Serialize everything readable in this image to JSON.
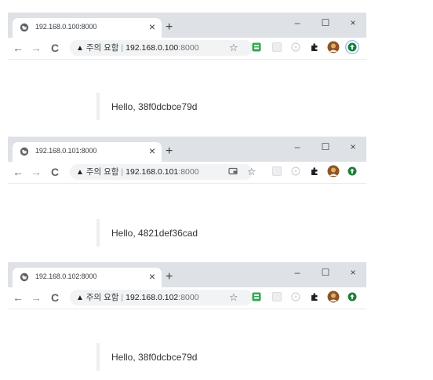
{
  "windows": [
    {
      "tab_title": "192.168.0.100:8000",
      "tab_close": "×",
      "new_tab": "+",
      "window_controls": {
        "minimize": "–",
        "maximize": "☐",
        "close": "×"
      },
      "nav": {
        "back": "←",
        "forward": "→",
        "reload": "C"
      },
      "security_warning": "주의 요함",
      "url_host": "192.168.0.100",
      "url_port": ":8000",
      "page_text": "Hello, 38f0dcbce79d",
      "has_cast_icon": false,
      "has_green_extension": true,
      "profile_focused": true
    },
    {
      "tab_title": "192.168.0.101:8000",
      "tab_close": "×",
      "new_tab": "+",
      "window_controls": {
        "minimize": "–",
        "maximize": "☐",
        "close": "×"
      },
      "nav": {
        "back": "←",
        "forward": "→",
        "reload": "C"
      },
      "security_warning": "주의 요함",
      "url_host": "192.168.0.101",
      "url_port": ":8000",
      "page_text": "Hello, 4821def36cad",
      "has_cast_icon": true,
      "has_green_extension": false,
      "profile_focused": false
    },
    {
      "tab_title": "192.168.0.102:8000",
      "tab_close": "×",
      "new_tab": "+",
      "window_controls": {
        "minimize": "–",
        "maximize": "☐",
        "close": "×"
      },
      "nav": {
        "back": "←",
        "forward": "→",
        "reload": "C"
      },
      "security_warning": "주의 요함",
      "url_host": "192.168.0.102",
      "url_port": ":8000",
      "page_text": "Hello, 38f0dcbce79d",
      "has_cast_icon": false,
      "has_green_extension": true,
      "profile_focused": false
    }
  ],
  "icons": {
    "favicon": "globe-icon",
    "warning": "warning-triangle-icon",
    "bookmark": "star-icon",
    "cast": "cast-icon",
    "extensions": "puzzle-icon",
    "profile": "avatar-icon",
    "update": "update-icon"
  },
  "colors": {
    "tabstrip_bg": "#dee1e6",
    "omnibox_bg": "#f1f3f4",
    "green_extension": "#34a853",
    "update_green": "#188038",
    "focus_ring": "#8ab4f8"
  }
}
